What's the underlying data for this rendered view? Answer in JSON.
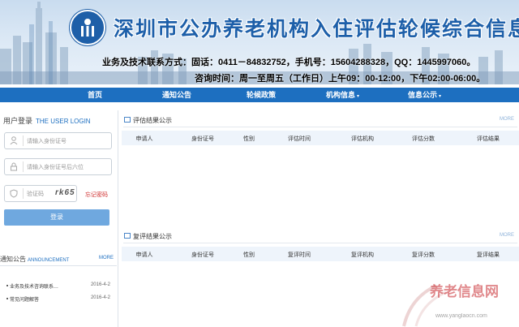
{
  "header": {
    "title": "深圳市公办养老机构入住评估轮候综合信息平台",
    "contact_line1": "业务及技术联系方式：固话：0411－84832752，手机号：15604288328，QQ：1445997060。",
    "contact_line2": "咨询时间：周一至周五（工作日）上午09：00-12:00，下午02:00-06:00。"
  },
  "nav": {
    "items": [
      {
        "label": "首页"
      },
      {
        "label": "通知公告"
      },
      {
        "label": "轮候政策"
      },
      {
        "label": "机构信息",
        "caret": "▾"
      },
      {
        "label": "信息公示",
        "caret": "▾"
      }
    ]
  },
  "login": {
    "title": "用户登录",
    "title_en": "THE USER LOGIN",
    "id_placeholder": "请输入身份证号",
    "pwd_placeholder": "请输入身份证号后六位",
    "captcha_placeholder": "验证码",
    "captcha_text": "rk65",
    "forgot_label": "忘记密码",
    "submit_label": "登录"
  },
  "notice": {
    "title": "通知公告",
    "title_en": "ANNOUNCEMENT",
    "more": "MORE",
    "items": [
      {
        "text": "业务及技术咨询联系…",
        "date": "2016-4-2"
      },
      {
        "text": "常见问题解答",
        "date": "2016-4-2"
      }
    ]
  },
  "eval_results": {
    "title": "评估结果公示",
    "more": "MORE",
    "columns": [
      "申请人",
      "身份证号",
      "性别",
      "评估时间",
      "评估机构",
      "评估分数",
      "评估结果"
    ]
  },
  "review_results": {
    "title": "复评结果公示",
    "more": "MORE",
    "columns": [
      "申请人",
      "身份证号",
      "性别",
      "复评时间",
      "复评机构",
      "复评分数",
      "复评结果"
    ]
  },
  "watermark": {
    "text": "养老信息网",
    "url": "www.yanglaocn.com"
  },
  "colors": {
    "nav_bg": "#1d6fc0",
    "title_blue": "#1d5fa9",
    "accent_red": "#d03030"
  }
}
